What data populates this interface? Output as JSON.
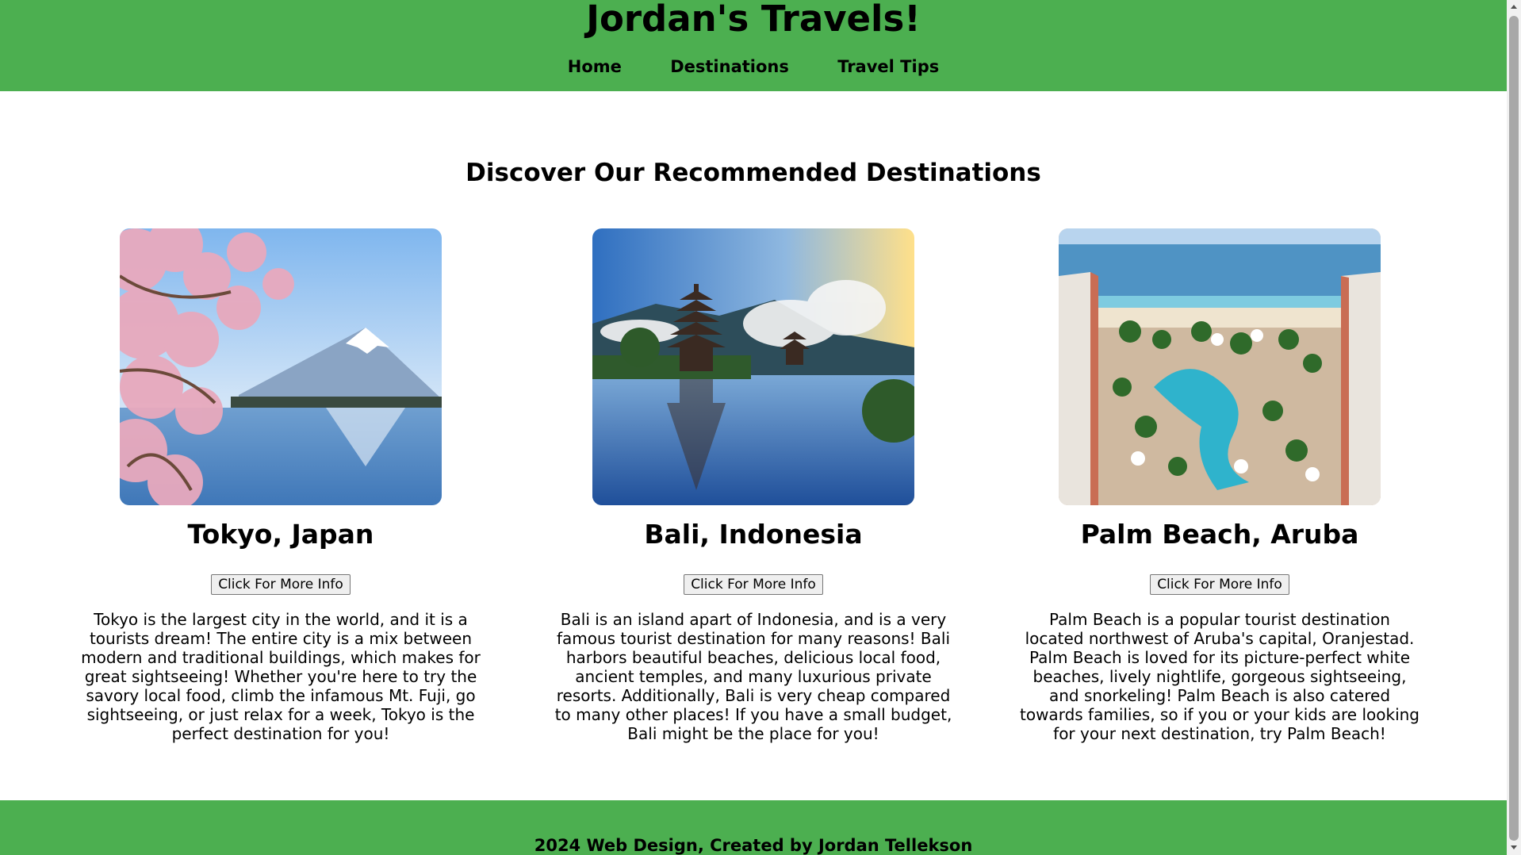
{
  "header": {
    "title": "Jordan's Travels!",
    "nav": [
      "Home",
      "Destinations",
      "Travel Tips"
    ]
  },
  "main": {
    "title": "Discover Our Recommended Destinations",
    "destinations": [
      {
        "name": "Tokyo, Japan",
        "button": "Click For More Info",
        "description": "Tokyo is the largest city in the world, and it is a tourists dream! The entire city is a mix between modern and traditional buildings, which makes for great sightseeing! Whether you're here to try the savory local food, climb the infamous Mt. Fuji, go sightseeing, or just relax for a week, Tokyo is the perfect destination for you!"
      },
      {
        "name": "Bali, Indonesia",
        "button": "Click For More Info",
        "description": "Bali is an island apart of Indonesia, and is a very famous tourist destination for many reasons! Bali harbors beautiful beaches, delicious local food, ancient temples, and many luxurious private resorts. Additionally, Bali is very cheap compared to many other places! If you have a small budget, Bali might be the place for you!"
      },
      {
        "name": "Palm Beach, Aruba",
        "button": "Click For More Info",
        "description": "Palm Beach is a popular tourist destination located northwest of Aruba's capital, Oranjestad. Palm Beach is loved for its picture-perfect white beaches, lively nightlife, gorgeous sightseeing, and snorkeling! Palm Beach is also catered towards families, so if you or your kids are looking for your next destination, try Palm Beach!"
      }
    ]
  },
  "footer": {
    "text": "2024 Web Design, Created by Jordan Tellekson"
  },
  "colors": {
    "header_bg": "#4caf50",
    "footer_bg": "#4caf50"
  }
}
